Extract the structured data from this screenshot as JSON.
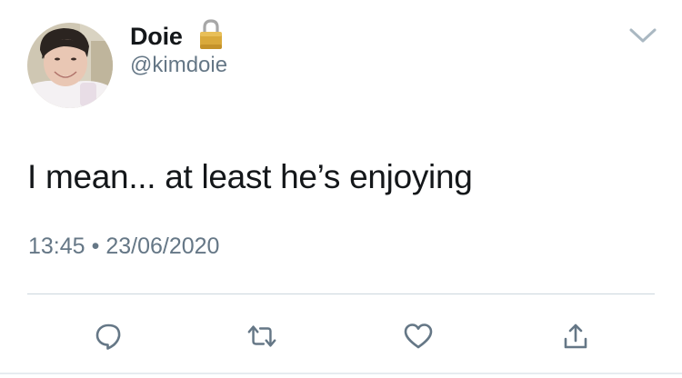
{
  "author": {
    "display_name": "Doie",
    "handle": "@kimdoie",
    "protected_icon": "lock-icon",
    "avatar": "profile-photo"
  },
  "tweet": {
    "text": "I mean... at least he’s enjoying",
    "time": "13:45",
    "separator": "•",
    "date": "23/06/2020"
  },
  "actions": [
    {
      "name": "reply",
      "icon": "reply-icon"
    },
    {
      "name": "retweet",
      "icon": "retweet-icon"
    },
    {
      "name": "like",
      "icon": "heart-icon"
    },
    {
      "name": "share",
      "icon": "share-icon"
    }
  ],
  "colors": {
    "text_primary": "#14171a",
    "text_secondary": "#657786",
    "icon": "#657786",
    "divider": "#ccd6dd"
  }
}
